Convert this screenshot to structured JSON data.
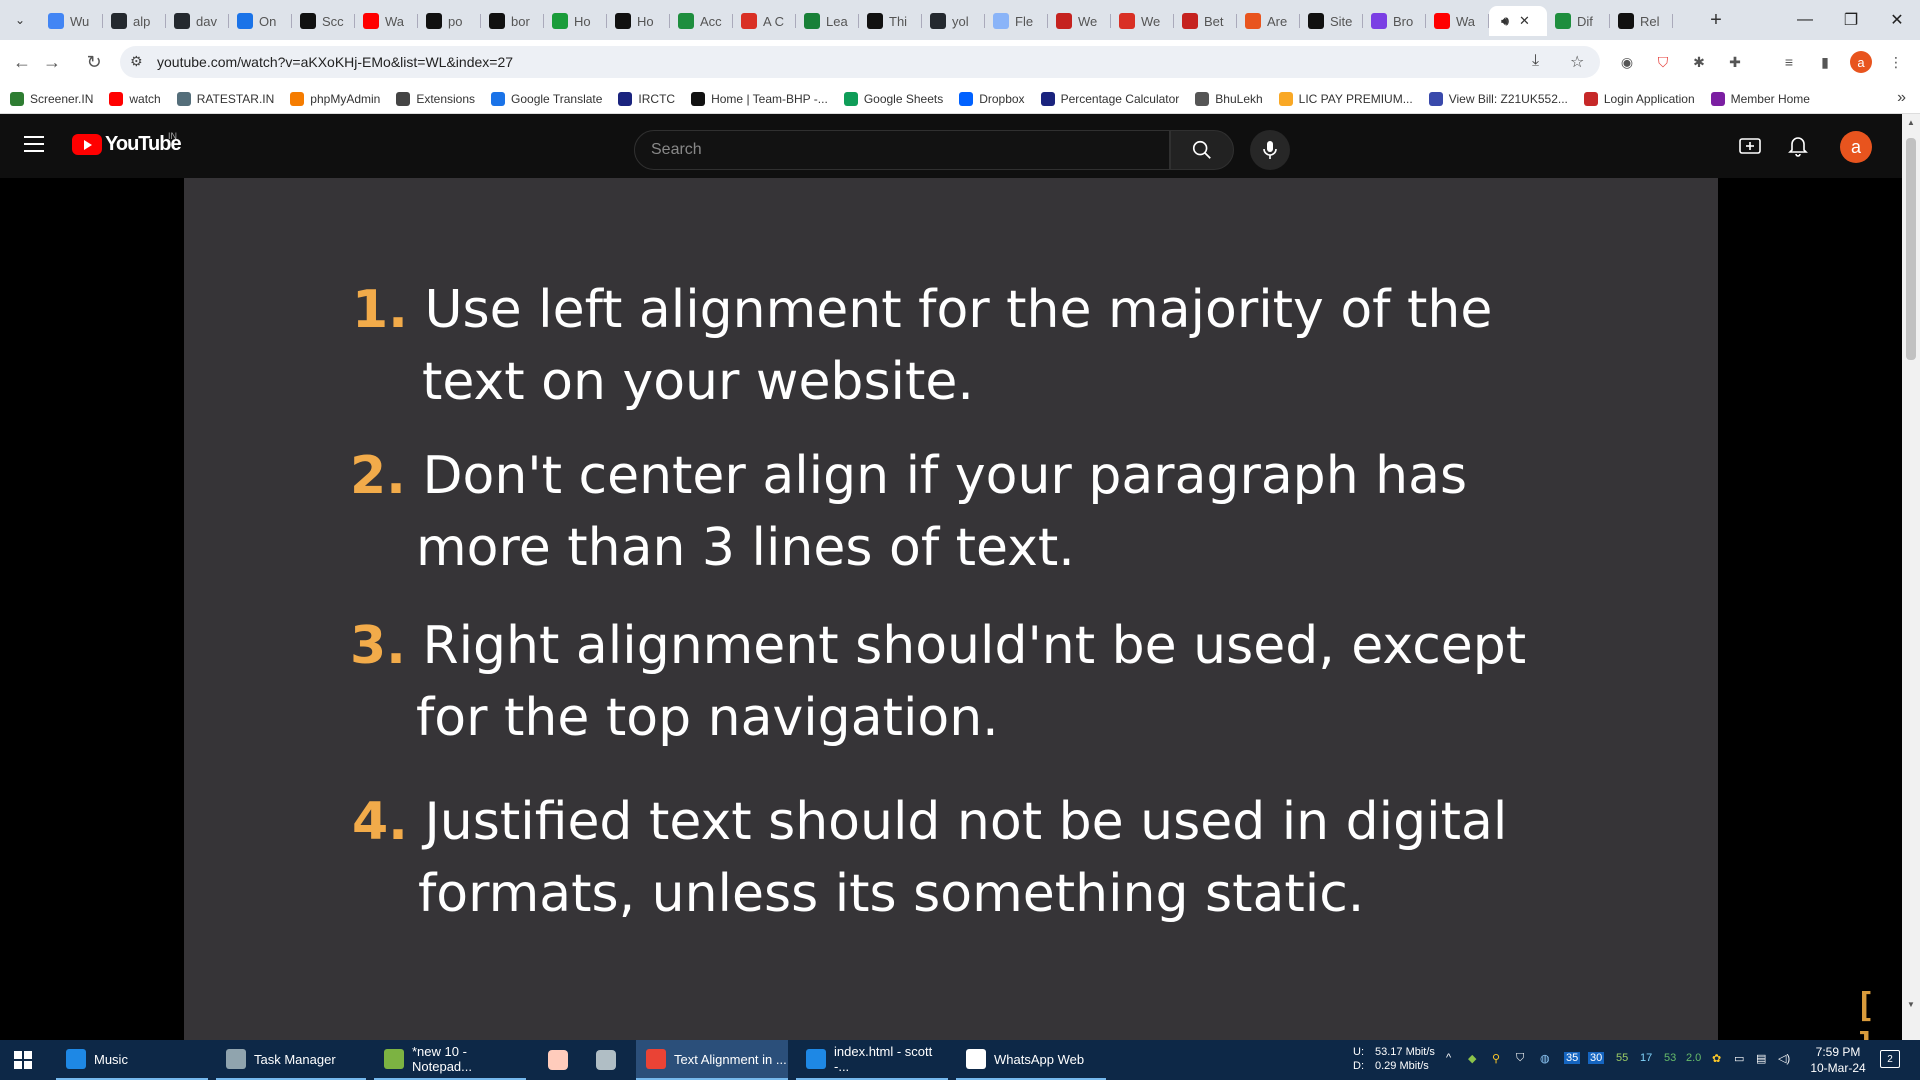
{
  "tabs": [
    {
      "label": "Wu",
      "icon": "google-icon",
      "color": "#4285f4"
    },
    {
      "label": "alp",
      "icon": "github-icon",
      "color": "#24292f"
    },
    {
      "label": "dav",
      "icon": "github-icon",
      "color": "#24292f"
    },
    {
      "label": "On",
      "icon": "ubuntu-icon",
      "color": "#1a73e8"
    },
    {
      "label": "Scc",
      "icon": "s-icon",
      "color": "#111111"
    },
    {
      "label": "Wa",
      "icon": "youtube-icon",
      "color": "#ff0000"
    },
    {
      "label": "po",
      "icon": "medium-icon",
      "color": "#111111"
    },
    {
      "label": "bor",
      "icon": "medium-icon",
      "color": "#111111"
    },
    {
      "label": "Ho",
      "icon": "w-icon",
      "color": "#1a9c3a"
    },
    {
      "label": "Ho",
      "icon": "a-icon",
      "color": "#111111"
    },
    {
      "label": "Acc",
      "icon": "link-icon",
      "color": "#1e8e3e"
    },
    {
      "label": "A C",
      "icon": "asterisk-icon",
      "color": "#d93025"
    },
    {
      "label": "Lea",
      "icon": "shield-icon",
      "color": "#188038"
    },
    {
      "label": "Thi",
      "icon": "dev-icon",
      "color": "#111111"
    },
    {
      "label": "yol",
      "icon": "github-icon",
      "color": "#24292f"
    },
    {
      "label": "Fle",
      "icon": "circle-icon",
      "color": "#8ab4f8"
    },
    {
      "label": "We",
      "icon": "nn-icon",
      "color": "#c5221f"
    },
    {
      "label": "We",
      "icon": "target-icon",
      "color": "#d93025"
    },
    {
      "label": "Bet",
      "icon": "nn-icon",
      "color": "#c5221f"
    },
    {
      "label": "Are",
      "icon": "firefox-icon",
      "color": "#e8541e"
    },
    {
      "label": "Site",
      "icon": "n-icon",
      "color": "#111111"
    },
    {
      "label": "Bro",
      "icon": "b-icon",
      "color": "#7b3fe4"
    },
    {
      "label": "Wa",
      "icon": "youtube-icon",
      "color": "#ff0000"
    }
  ],
  "tabs_after": [
    {
      "label": "Dif",
      "icon": "link-icon",
      "color": "#1e8e3e"
    },
    {
      "label": "Rel",
      "icon": "medium-icon",
      "color": "#111111"
    }
  ],
  "omnibox": {
    "url": "youtube.com/watch?v=aKXoKHj-EMo&list=WL&index=27"
  },
  "bookmarks": [
    {
      "label": "Screener.IN",
      "icon": "bar-chart-icon",
      "color": "#2e7d32"
    },
    {
      "label": "watch",
      "icon": "youtube-icon",
      "color": "#ff0000"
    },
    {
      "label": "RATESTAR.IN",
      "icon": "chart-icon",
      "color": "#546e7a"
    },
    {
      "label": "phpMyAdmin",
      "icon": "phpmyadmin-icon",
      "color": "#f57c00"
    },
    {
      "label": "Extensions",
      "icon": "puzzle-icon",
      "color": "#444444"
    },
    {
      "label": "Google Translate",
      "icon": "translate-icon",
      "color": "#1a73e8"
    },
    {
      "label": "IRCTC",
      "icon": "irctc-icon",
      "color": "#1a237e"
    },
    {
      "label": "Home | Team-BHP -...",
      "icon": "teambhp-icon",
      "color": "#111111"
    },
    {
      "label": "Google Sheets",
      "icon": "sheets-icon",
      "color": "#0f9d58"
    },
    {
      "label": "Dropbox",
      "icon": "dropbox-icon",
      "color": "#0061ff"
    },
    {
      "label": "Percentage Calculator",
      "icon": "percent-icon",
      "color": "#1a237e"
    },
    {
      "label": "BhuLekh",
      "icon": "globe-icon",
      "color": "#555555"
    },
    {
      "label": "LIC PAY PREMIUM...",
      "icon": "lic-icon",
      "color": "#f9a825"
    },
    {
      "label": "View Bill: Z21UK552...",
      "icon": "bill-icon",
      "color": "#3949ab"
    },
    {
      "label": "Login Application",
      "icon": "login-icon",
      "color": "#c62828"
    },
    {
      "label": "Member Home",
      "icon": "member-icon",
      "color": "#7b1fa2"
    }
  ],
  "youtube": {
    "logo_text": "YouTube",
    "country": "IN",
    "search_placeholder": "Search",
    "avatar_letter": "a"
  },
  "slide": {
    "points": [
      {
        "num": "1.",
        "line1": "Use left alignment for the majority of the",
        "line2": "text on your website."
      },
      {
        "num": "2.",
        "line1": "Don't center align if your paragraph has",
        "line2": "more than 3 lines of text."
      },
      {
        "num": "3.",
        "line1": "Right alignment should'nt be used, except",
        "line2": "for the top navigation."
      },
      {
        "num": "4.",
        "line1": "Justified text should not be used in digital",
        "line2": "formats, unless its something static."
      }
    ],
    "corner_mark": "[ ]"
  },
  "taskbar": {
    "apps": [
      {
        "label": "Music",
        "icon": "music-icon",
        "color": "#1e88e5"
      },
      {
        "label": "Task Manager",
        "icon": "task-manager-icon",
        "color": "#90a4ae"
      },
      {
        "label": "*new 10 - Notepad...",
        "icon": "notepad-icon",
        "color": "#7cb342"
      },
      {
        "label": "Text Alignment in ...",
        "icon": "chrome-icon",
        "color": "#ea4335"
      },
      {
        "label": "index.html - scott -...",
        "icon": "vscode-icon",
        "color": "#1e88e5"
      },
      {
        "label": "WhatsApp Web",
        "icon": "whatsapp-icon",
        "color": "#ffffff"
      }
    ],
    "network": {
      "up_label": "U:",
      "up": "53.17 Mbit/s",
      "down_label": "D:",
      "down": "0.29 Mbit/s"
    },
    "tray_numbers": [
      "35",
      "30",
      "55",
      "17",
      "53",
      "2.0"
    ],
    "time": "7:59 PM",
    "date": "10-Mar-24",
    "notification_count": "2"
  }
}
